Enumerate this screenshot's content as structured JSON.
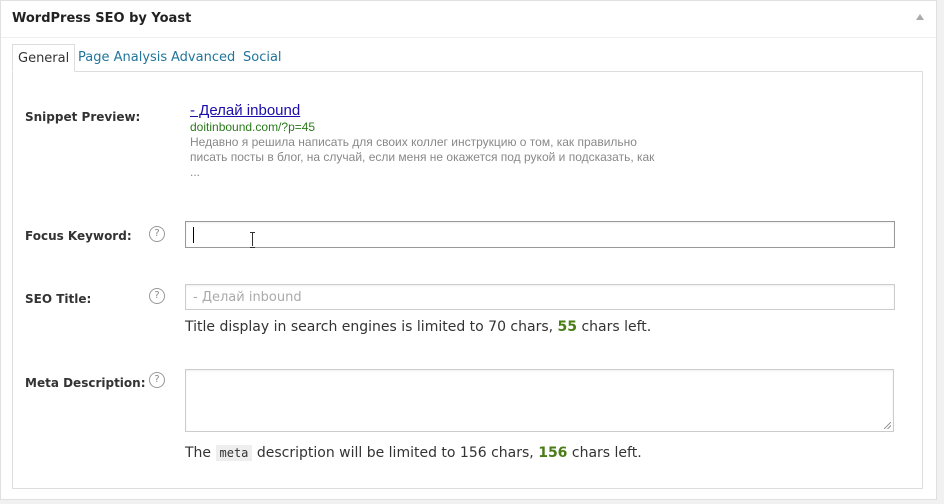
{
  "metabox": {
    "title": "WordPress SEO by Yoast",
    "toggle_icon": "triangle-up-icon"
  },
  "tabs": [
    {
      "label": "General",
      "active": true
    },
    {
      "label": "Page Analysis",
      "active": false
    },
    {
      "label": "Advanced",
      "active": false
    },
    {
      "label": "Social",
      "active": false
    }
  ],
  "snippet": {
    "label": "Snippet Preview:",
    "title": "- Делай inbound",
    "url": "doitinbound.com/?p=45",
    "description_line1": "Недавно я решила написать для своих коллег инструкцию о том, как правильно",
    "description_line2": "писать посты в блог, на случай, если меня не окажется под рукой и подсказать, как",
    "description_line3": "..."
  },
  "focus_keyword": {
    "label": "Focus Keyword:",
    "help": "?",
    "value": ""
  },
  "seo_title": {
    "label": "SEO Title:",
    "help": "?",
    "placeholder": "- Делай inbound",
    "note_prefix": "Title display in search engines is limited to 70 chars, ",
    "chars_left": "55",
    "note_suffix": " chars left."
  },
  "meta_description": {
    "label": "Meta Description:",
    "help": "?",
    "value": "",
    "note_the": "The ",
    "note_code": "meta",
    "note_prefix": " description will be limited to 156 chars, ",
    "chars_left": "156",
    "note_suffix": " chars left."
  },
  "colors": {
    "link": "#21759b",
    "snippet_title": "#1a0dab",
    "snippet_url": "#2a7a1a",
    "count_green": "#4a7d16"
  }
}
